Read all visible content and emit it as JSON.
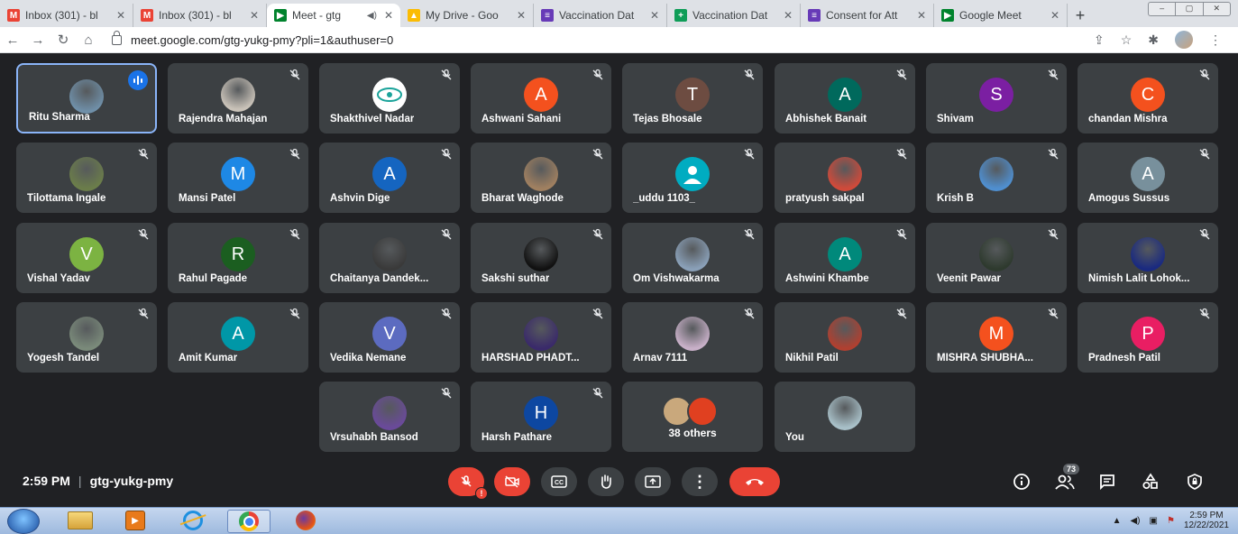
{
  "browser": {
    "tabs": [
      {
        "title": "Inbox (301) - bl",
        "icon": "gmail-icon",
        "color": "#ea4335",
        "glyph": "M"
      },
      {
        "title": "Inbox (301) - bl",
        "icon": "gmail-icon",
        "color": "#ea4335",
        "glyph": "M"
      },
      {
        "title": "Meet - gtg",
        "icon": "meet-icon",
        "color": "#00832d",
        "glyph": "▶",
        "active": true
      },
      {
        "title": "My Drive - Goo",
        "icon": "drive-icon",
        "color": "#fbbc04",
        "glyph": "▲"
      },
      {
        "title": "Vaccination Dat",
        "icon": "forms-icon",
        "color": "#673ab7",
        "glyph": "≡"
      },
      {
        "title": "Vaccination Dat",
        "icon": "sheets-icon",
        "color": "#0f9d58",
        "glyph": "+"
      },
      {
        "title": "Consent for Att",
        "icon": "forms-icon",
        "color": "#673ab7",
        "glyph": "≡"
      },
      {
        "title": "Google Meet",
        "icon": "meet-icon",
        "color": "#00832d",
        "glyph": "▶"
      }
    ],
    "new_tab": "+",
    "url": "meet.google.com/gtg-yukg-pmy?pli=1&authuser=0"
  },
  "participants": [
    {
      "name": "Ritu Sharma",
      "avatar": "photo",
      "color": "#6f8fa8",
      "speaking": true
    },
    {
      "name": "Rajendra Mahajan",
      "avatar": "photo",
      "color": "#c9c2b8"
    },
    {
      "name": "Shakthivel Nadar",
      "avatar": "logo",
      "color": "#ffffff"
    },
    {
      "name": "Ashwani Sahani",
      "avatar": "letter",
      "letter": "A",
      "color": "#f4511e"
    },
    {
      "name": "Tejas Bhosale",
      "avatar": "letter",
      "letter": "T",
      "color": "#6d4c41"
    },
    {
      "name": "Abhishek Banait",
      "avatar": "letter",
      "letter": "A",
      "color": "#00695c"
    },
    {
      "name": "Shivam",
      "avatar": "letter",
      "letter": "S",
      "color": "#7b1fa2"
    },
    {
      "name": "chandan Mishra",
      "avatar": "letter",
      "letter": "C",
      "color": "#f4511e"
    },
    {
      "name": "Tilottama Ingale",
      "avatar": "photo",
      "color": "#6b7d4a"
    },
    {
      "name": "Mansi Patel",
      "avatar": "letter",
      "letter": "M",
      "color": "#1e88e5"
    },
    {
      "name": "Ashvin Dige",
      "avatar": "letter",
      "letter": "A",
      "color": "#1565c0"
    },
    {
      "name": "Bharat Waghode",
      "avatar": "photo",
      "color": "#a08060"
    },
    {
      "name": "_uddu 1103_",
      "avatar": "person",
      "color": "#00acc1"
    },
    {
      "name": "pratyush sakpal",
      "avatar": "photo",
      "color": "#d04a3a"
    },
    {
      "name": "Krish B",
      "avatar": "photo",
      "color": "#4f8fd0"
    },
    {
      "name": "Amogus Sussus",
      "avatar": "letter",
      "letter": "A",
      "color": "#78909c"
    },
    {
      "name": "Vishal Yadav",
      "avatar": "letter",
      "letter": "V",
      "color": "#7cb342"
    },
    {
      "name": "Rahul Pagade",
      "avatar": "letter",
      "letter": "R",
      "color": "#1b5e20"
    },
    {
      "name": "Chaitanya Dandek...",
      "avatar": "photo",
      "color": "#3a3a3a"
    },
    {
      "name": "Sakshi suthar",
      "avatar": "photo",
      "color": "#111111"
    },
    {
      "name": "Om Vishwakarma",
      "avatar": "photo",
      "color": "#8aa0b8"
    },
    {
      "name": "Ashwini Khambe",
      "avatar": "letter",
      "letter": "A",
      "color": "#00897b"
    },
    {
      "name": "Veenit Pawar",
      "avatar": "photo",
      "color": "#2e3a2e"
    },
    {
      "name": "Nimish Lalit Lohok...",
      "avatar": "photo",
      "color": "#1a2a80"
    },
    {
      "name": "Yogesh Tandel",
      "avatar": "photo",
      "color": "#7a8a7a"
    },
    {
      "name": "Amit Kumar",
      "avatar": "letter",
      "letter": "A",
      "color": "#0097a7"
    },
    {
      "name": "Vedika Nemane",
      "avatar": "letter",
      "letter": "V",
      "color": "#5c6bc0"
    },
    {
      "name": "HARSHAD PHADT...",
      "avatar": "photo",
      "color": "#3a2a6a"
    },
    {
      "name": "Arnav 7111",
      "avatar": "photo",
      "color": "#c8b0c8"
    },
    {
      "name": "Nikhil Patil",
      "avatar": "photo",
      "color": "#b04030"
    },
    {
      "name": "MISHRA SHUBHA...",
      "avatar": "letter",
      "letter": "M",
      "color": "#f4511e"
    },
    {
      "name": "Pradnesh Patil",
      "avatar": "letter",
      "letter": "P",
      "color": "#e91e63"
    },
    {
      "name": "Vrsuhabh Bansod",
      "avatar": "photo",
      "color": "#6a4a9a"
    },
    {
      "name": "Harsh Pathare",
      "avatar": "letter",
      "letter": "H",
      "color": "#0d47a1"
    },
    {
      "name": "38 others",
      "avatar": "others"
    },
    {
      "name": "You",
      "avatar": "photo",
      "color": "#a8c0c8"
    }
  ],
  "meeting": {
    "time": "2:59 PM",
    "separator": "|",
    "code": "gtg-yukg-pmy",
    "participant_count": "73"
  },
  "taskbar": {
    "clock_time": "2:59 PM",
    "clock_date": "12/22/2021"
  }
}
